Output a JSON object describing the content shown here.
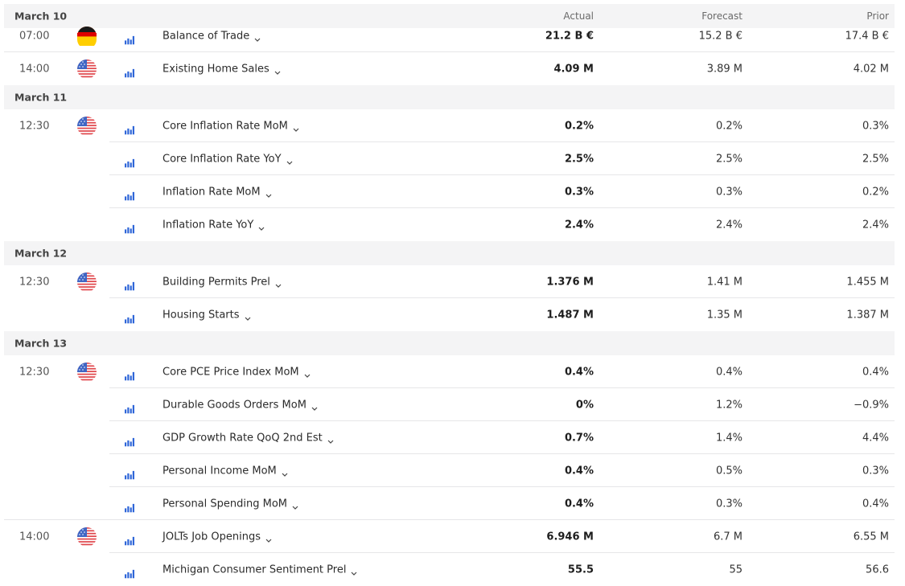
{
  "columns": {
    "actual": "Actual",
    "forecast": "Forecast",
    "prior": "Prior"
  },
  "days": [
    {
      "date": "March 10",
      "show_columns": true,
      "events": [
        {
          "time": "07:00",
          "country": "DE",
          "name": "Balance of Trade",
          "actual": "21.2 B €",
          "forecast": "15.2 B €",
          "prior": "17.4 B €"
        },
        {
          "time": "14:00",
          "country": "US",
          "name": "Existing Home Sales",
          "actual": "4.09 M",
          "forecast": "3.89 M",
          "prior": "4.02 M"
        }
      ]
    },
    {
      "date": "March 11",
      "show_columns": false,
      "events": [
        {
          "time": "12:30",
          "country": "US",
          "name": "Core Inflation Rate MoM",
          "actual": "0.2%",
          "forecast": "0.2%",
          "prior": "0.3%"
        },
        {
          "time": "",
          "country": "",
          "name": "Core Inflation Rate YoY",
          "actual": "2.5%",
          "forecast": "2.5%",
          "prior": "2.5%"
        },
        {
          "time": "",
          "country": "",
          "name": "Inflation Rate MoM",
          "actual": "0.3%",
          "forecast": "0.3%",
          "prior": "0.2%"
        },
        {
          "time": "",
          "country": "",
          "name": "Inflation Rate YoY",
          "actual": "2.4%",
          "forecast": "2.4%",
          "prior": "2.4%"
        }
      ]
    },
    {
      "date": "March 12",
      "show_columns": false,
      "events": [
        {
          "time": "12:30",
          "country": "US",
          "name": "Building Permits Prel",
          "actual": "1.376 M",
          "forecast": "1.41 M",
          "prior": "1.455 M"
        },
        {
          "time": "",
          "country": "",
          "name": "Housing Starts",
          "actual": "1.487 M",
          "forecast": "1.35 M",
          "prior": "1.387 M"
        }
      ]
    },
    {
      "date": "March 13",
      "show_columns": false,
      "events": [
        {
          "time": "12:30",
          "country": "US",
          "name": "Core PCE Price Index MoM",
          "actual": "0.4%",
          "forecast": "0.4%",
          "prior": "0.4%"
        },
        {
          "time": "",
          "country": "",
          "name": "Durable Goods Orders MoM",
          "actual": "0%",
          "forecast": "1.2%",
          "prior": "−0.9%"
        },
        {
          "time": "",
          "country": "",
          "name": "GDP Growth Rate QoQ 2nd Est",
          "actual": "0.7%",
          "forecast": "1.4%",
          "prior": "4.4%"
        },
        {
          "time": "",
          "country": "",
          "name": "Personal Income MoM",
          "actual": "0.4%",
          "forecast": "0.5%",
          "prior": "0.3%"
        },
        {
          "time": "",
          "country": "",
          "name": "Personal Spending MoM",
          "actual": "0.4%",
          "forecast": "0.3%",
          "prior": "0.4%"
        },
        {
          "time": "14:00",
          "country": "US",
          "name": "JOLTs Job Openings",
          "actual": "6.946 M",
          "forecast": "6.7 M",
          "prior": "6.55 M"
        },
        {
          "time": "",
          "country": "",
          "name": "Michigan Consumer Sentiment Prel",
          "actual": "55.5",
          "forecast": "55",
          "prior": "56.6"
        }
      ]
    }
  ],
  "icons": {
    "chart": "bar-chart-icon",
    "chevron": "chevron-down-icon",
    "flag_de": "germany-flag-icon",
    "flag_us": "usa-flag-icon"
  },
  "colors": {
    "chart_icon": "#2f66d8",
    "header_bg": "#f4f4f5",
    "separator": "#e6e6e8",
    "de_black": "#1a1a1a",
    "de_red": "#dd0000",
    "de_gold": "#ffce00",
    "us_red": "#e0474c",
    "us_blue": "#3f66c4"
  }
}
